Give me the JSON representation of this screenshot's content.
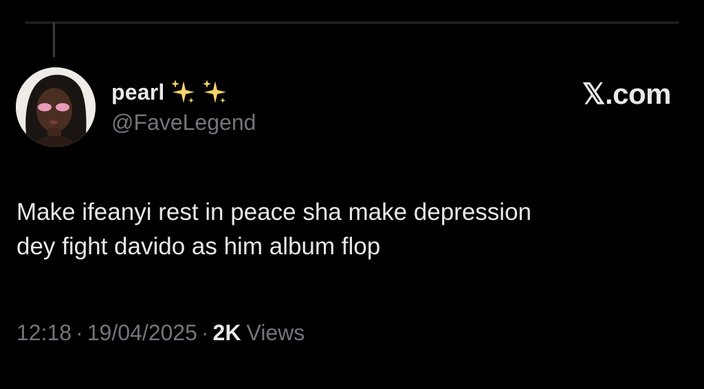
{
  "tweet": {
    "author": {
      "display_name": "pearl",
      "emoji_icons": [
        "sparkles-icon",
        "sparkles-icon"
      ],
      "handle": "@FaveLegend",
      "avatar_icon": "profile-photo-avatar"
    },
    "brand": "𝕏.com",
    "text_lines": [
      "Make ifeanyi rest in peace sha make depression",
      "dey fight davido as him album flop"
    ],
    "meta": {
      "time": "12:18",
      "separator": "·",
      "date": "19/04/2025",
      "views_count": "2K",
      "views_label": "Views"
    }
  },
  "colors": {
    "background": "#000000",
    "primary_text": "#e7e9ea",
    "secondary_text": "#71767b",
    "sparkle": "#f5d36b"
  }
}
